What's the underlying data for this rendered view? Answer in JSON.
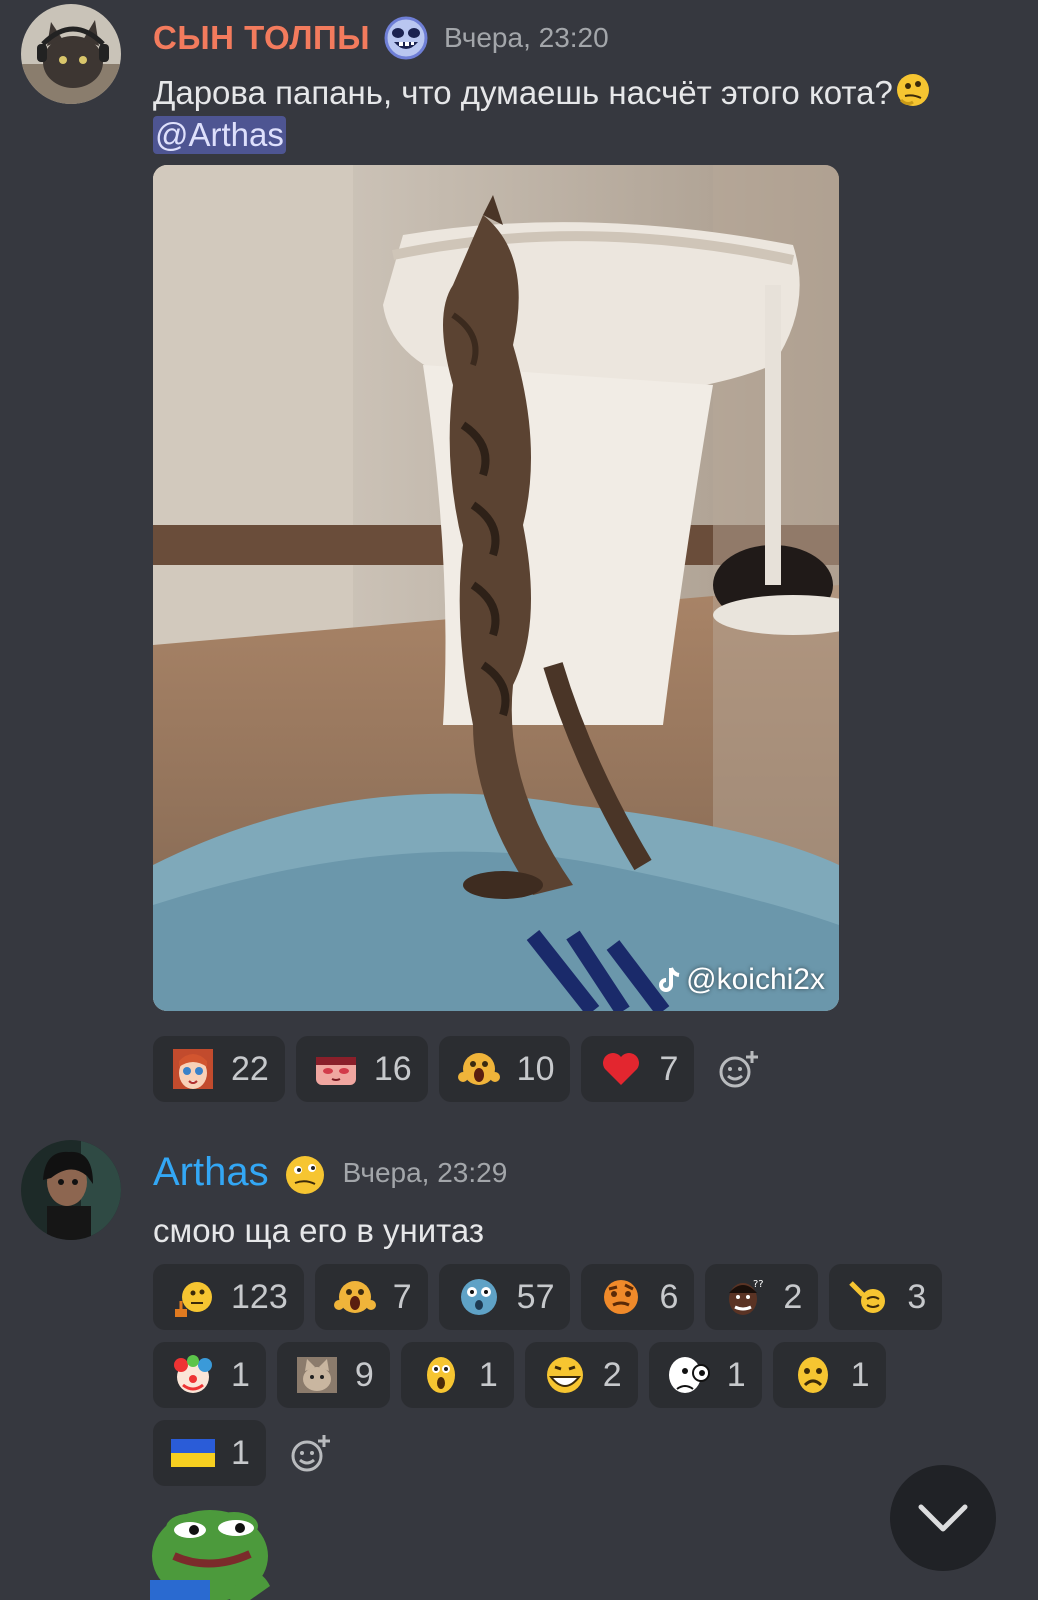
{
  "messages": [
    {
      "author": "СЫН ТОЛПЫ",
      "author_color": "#f37b5d",
      "timestamp": "Вчера, 23:20",
      "text": "Дарова папань, что думаешь насчёт этого кота?",
      "mention": "@Arthas",
      "attachment_watermark": "@koichi2x",
      "reactions": [
        {
          "icon": "anime-girl-emoji",
          "count": "22"
        },
        {
          "icon": "blushing-anime-emoji",
          "count": "16"
        },
        {
          "icon": "screaming-emoji",
          "count": "10"
        },
        {
          "icon": "heart-emoji",
          "count": "7"
        }
      ]
    },
    {
      "author": "Arthas",
      "author_color": "#33a7f5",
      "timestamp": "Вчера, 23:29",
      "text": "смою ща его в унитаз",
      "reactions": [
        {
          "icon": "thinking-hmm-emoji",
          "count": "123"
        },
        {
          "icon": "screaming-emoji",
          "count": "7"
        },
        {
          "icon": "shocked-blue-face-emoji",
          "count": "57"
        },
        {
          "icon": "raised-eyebrow-emoji",
          "count": "6"
        },
        {
          "icon": "confused-man-emoji",
          "count": "2"
        },
        {
          "icon": "finger-gun-emoji",
          "count": "3"
        },
        {
          "icon": "clown-emoji",
          "count": "1"
        },
        {
          "icon": "cat-photo-emoji",
          "count": "9"
        },
        {
          "icon": "worried-face-emoji",
          "count": "1"
        },
        {
          "icon": "grinning-face-emoji",
          "count": "2"
        },
        {
          "icon": "googly-eyes-emoji",
          "count": "1"
        },
        {
          "icon": "sad-face-emoji",
          "count": "1"
        },
        {
          "icon": "ukraine-flag-emoji",
          "count": "1"
        }
      ]
    }
  ]
}
